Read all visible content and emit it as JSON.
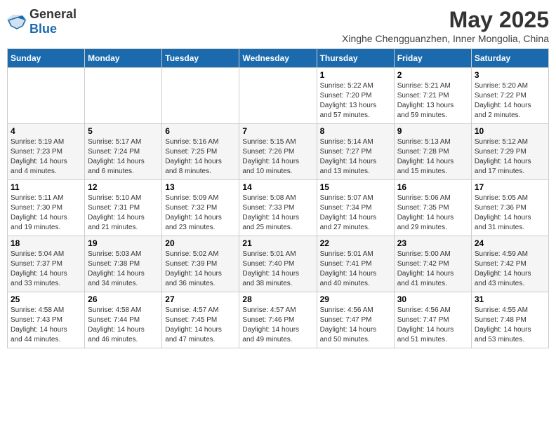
{
  "logo": {
    "text_general": "General",
    "text_blue": "Blue"
  },
  "title": {
    "month": "May 2025",
    "location": "Xinghe Chengguanzhen, Inner Mongolia, China"
  },
  "weekdays": [
    "Sunday",
    "Monday",
    "Tuesday",
    "Wednesday",
    "Thursday",
    "Friday",
    "Saturday"
  ],
  "weeks": [
    [
      {
        "day": "",
        "info": ""
      },
      {
        "day": "",
        "info": ""
      },
      {
        "day": "",
        "info": ""
      },
      {
        "day": "",
        "info": ""
      },
      {
        "day": "1",
        "info": "Sunrise: 5:22 AM\nSunset: 7:20 PM\nDaylight: 13 hours\nand 57 minutes."
      },
      {
        "day": "2",
        "info": "Sunrise: 5:21 AM\nSunset: 7:21 PM\nDaylight: 13 hours\nand 59 minutes."
      },
      {
        "day": "3",
        "info": "Sunrise: 5:20 AM\nSunset: 7:22 PM\nDaylight: 14 hours\nand 2 minutes."
      }
    ],
    [
      {
        "day": "4",
        "info": "Sunrise: 5:19 AM\nSunset: 7:23 PM\nDaylight: 14 hours\nand 4 minutes."
      },
      {
        "day": "5",
        "info": "Sunrise: 5:17 AM\nSunset: 7:24 PM\nDaylight: 14 hours\nand 6 minutes."
      },
      {
        "day": "6",
        "info": "Sunrise: 5:16 AM\nSunset: 7:25 PM\nDaylight: 14 hours\nand 8 minutes."
      },
      {
        "day": "7",
        "info": "Sunrise: 5:15 AM\nSunset: 7:26 PM\nDaylight: 14 hours\nand 10 minutes."
      },
      {
        "day": "8",
        "info": "Sunrise: 5:14 AM\nSunset: 7:27 PM\nDaylight: 14 hours\nand 13 minutes."
      },
      {
        "day": "9",
        "info": "Sunrise: 5:13 AM\nSunset: 7:28 PM\nDaylight: 14 hours\nand 15 minutes."
      },
      {
        "day": "10",
        "info": "Sunrise: 5:12 AM\nSunset: 7:29 PM\nDaylight: 14 hours\nand 17 minutes."
      }
    ],
    [
      {
        "day": "11",
        "info": "Sunrise: 5:11 AM\nSunset: 7:30 PM\nDaylight: 14 hours\nand 19 minutes."
      },
      {
        "day": "12",
        "info": "Sunrise: 5:10 AM\nSunset: 7:31 PM\nDaylight: 14 hours\nand 21 minutes."
      },
      {
        "day": "13",
        "info": "Sunrise: 5:09 AM\nSunset: 7:32 PM\nDaylight: 14 hours\nand 23 minutes."
      },
      {
        "day": "14",
        "info": "Sunrise: 5:08 AM\nSunset: 7:33 PM\nDaylight: 14 hours\nand 25 minutes."
      },
      {
        "day": "15",
        "info": "Sunrise: 5:07 AM\nSunset: 7:34 PM\nDaylight: 14 hours\nand 27 minutes."
      },
      {
        "day": "16",
        "info": "Sunrise: 5:06 AM\nSunset: 7:35 PM\nDaylight: 14 hours\nand 29 minutes."
      },
      {
        "day": "17",
        "info": "Sunrise: 5:05 AM\nSunset: 7:36 PM\nDaylight: 14 hours\nand 31 minutes."
      }
    ],
    [
      {
        "day": "18",
        "info": "Sunrise: 5:04 AM\nSunset: 7:37 PM\nDaylight: 14 hours\nand 33 minutes."
      },
      {
        "day": "19",
        "info": "Sunrise: 5:03 AM\nSunset: 7:38 PM\nDaylight: 14 hours\nand 34 minutes."
      },
      {
        "day": "20",
        "info": "Sunrise: 5:02 AM\nSunset: 7:39 PM\nDaylight: 14 hours\nand 36 minutes."
      },
      {
        "day": "21",
        "info": "Sunrise: 5:01 AM\nSunset: 7:40 PM\nDaylight: 14 hours\nand 38 minutes."
      },
      {
        "day": "22",
        "info": "Sunrise: 5:01 AM\nSunset: 7:41 PM\nDaylight: 14 hours\nand 40 minutes."
      },
      {
        "day": "23",
        "info": "Sunrise: 5:00 AM\nSunset: 7:42 PM\nDaylight: 14 hours\nand 41 minutes."
      },
      {
        "day": "24",
        "info": "Sunrise: 4:59 AM\nSunset: 7:42 PM\nDaylight: 14 hours\nand 43 minutes."
      }
    ],
    [
      {
        "day": "25",
        "info": "Sunrise: 4:58 AM\nSunset: 7:43 PM\nDaylight: 14 hours\nand 44 minutes."
      },
      {
        "day": "26",
        "info": "Sunrise: 4:58 AM\nSunset: 7:44 PM\nDaylight: 14 hours\nand 46 minutes."
      },
      {
        "day": "27",
        "info": "Sunrise: 4:57 AM\nSunset: 7:45 PM\nDaylight: 14 hours\nand 47 minutes."
      },
      {
        "day": "28",
        "info": "Sunrise: 4:57 AM\nSunset: 7:46 PM\nDaylight: 14 hours\nand 49 minutes."
      },
      {
        "day": "29",
        "info": "Sunrise: 4:56 AM\nSunset: 7:47 PM\nDaylight: 14 hours\nand 50 minutes."
      },
      {
        "day": "30",
        "info": "Sunrise: 4:56 AM\nSunset: 7:47 PM\nDaylight: 14 hours\nand 51 minutes."
      },
      {
        "day": "31",
        "info": "Sunrise: 4:55 AM\nSunset: 7:48 PM\nDaylight: 14 hours\nand 53 minutes."
      }
    ]
  ]
}
